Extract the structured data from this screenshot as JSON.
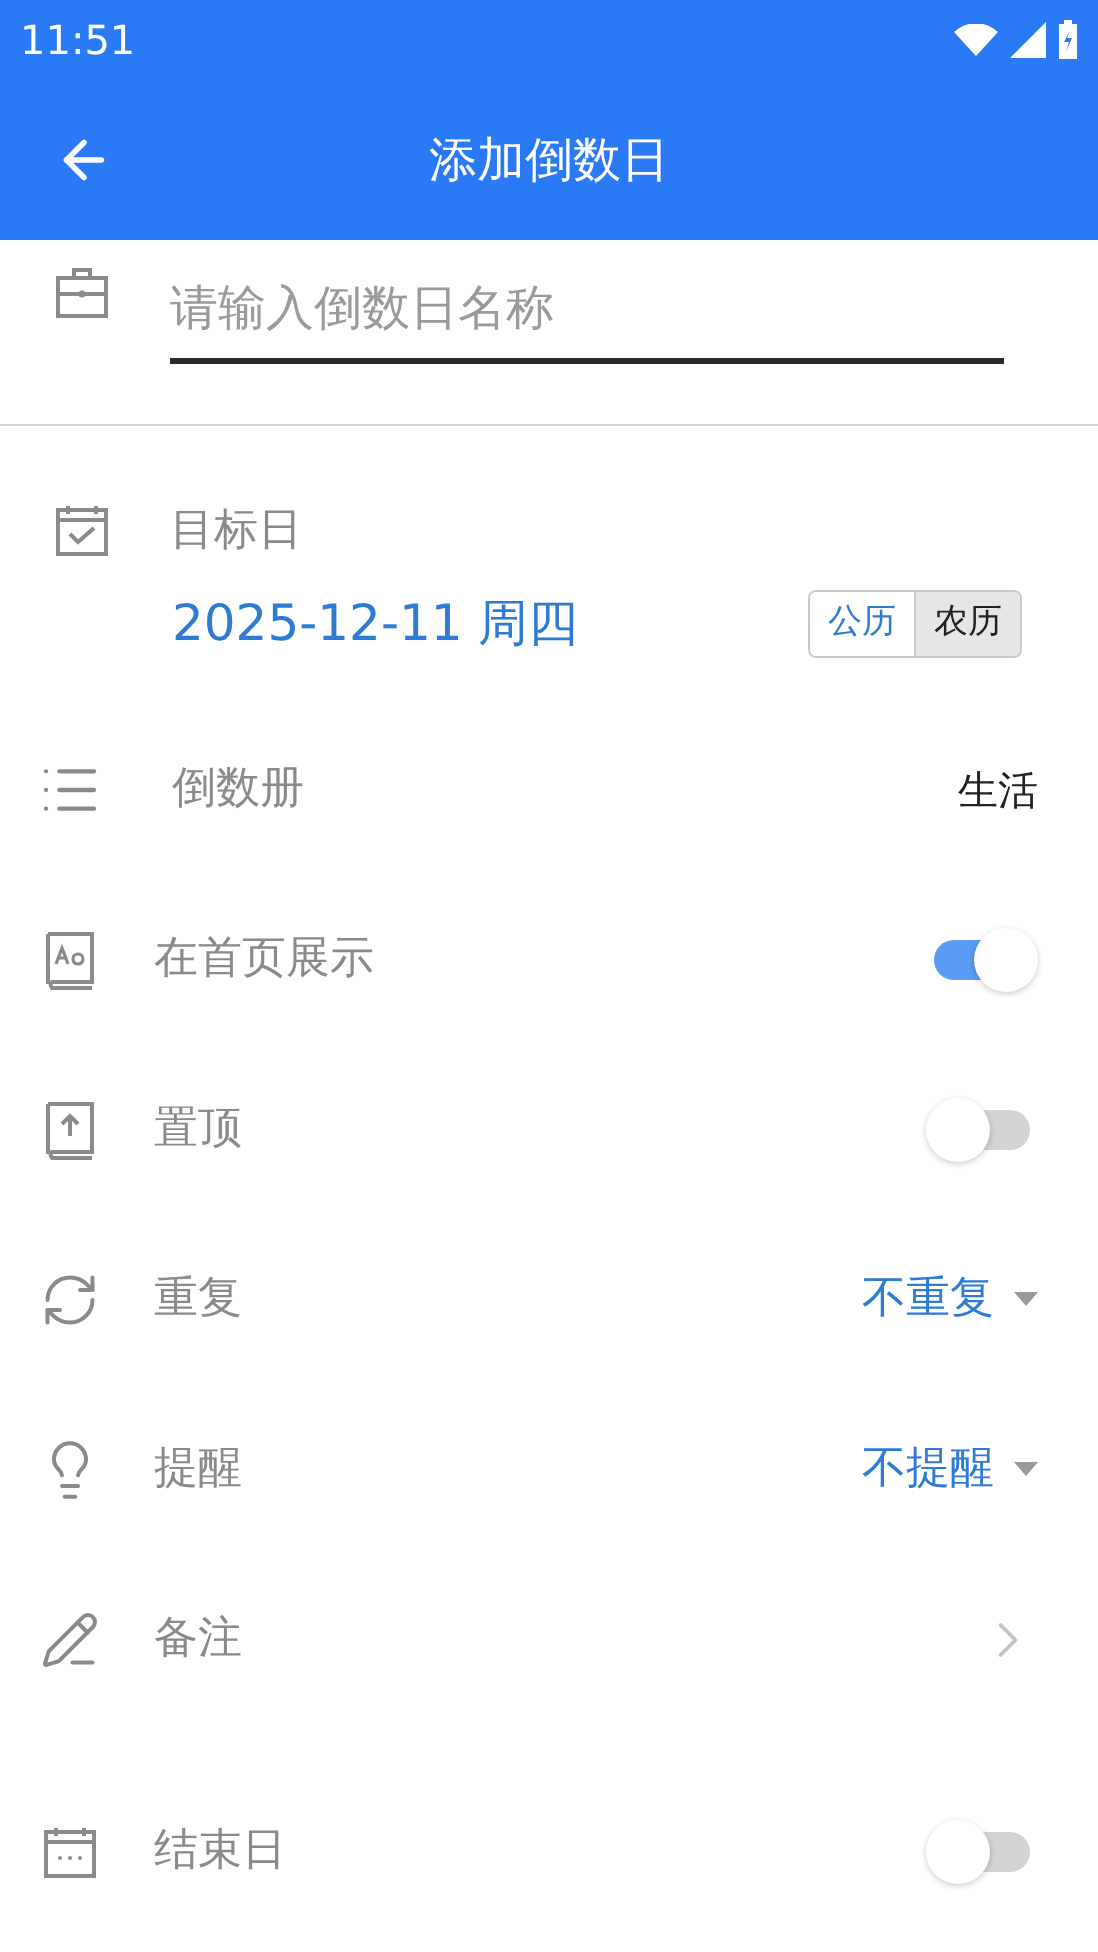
{
  "status_bar": {
    "time": "11:51"
  },
  "app_bar": {
    "title": "添加倒数日"
  },
  "name_field": {
    "placeholder": "请输入倒数日名称"
  },
  "target_date": {
    "label": "目标日",
    "value": "2025-12-11 周四",
    "calendars": [
      {
        "label": "公历",
        "selected": true
      },
      {
        "label": "农历",
        "selected": false
      }
    ]
  },
  "rows": [
    {
      "kind": "value",
      "label": "倒数册",
      "value": "生活"
    },
    {
      "kind": "switch",
      "label": "在首页展示",
      "on": true
    },
    {
      "kind": "switch",
      "label": "置顶",
      "on": false
    },
    {
      "kind": "dropdown",
      "label": "重复",
      "value": "不重复"
    },
    {
      "kind": "dropdown",
      "label": "提醒",
      "value": "不提醒"
    },
    {
      "kind": "link",
      "label": "备注"
    },
    {
      "kind": "switch",
      "label": "结束日",
      "on": false
    }
  ]
}
